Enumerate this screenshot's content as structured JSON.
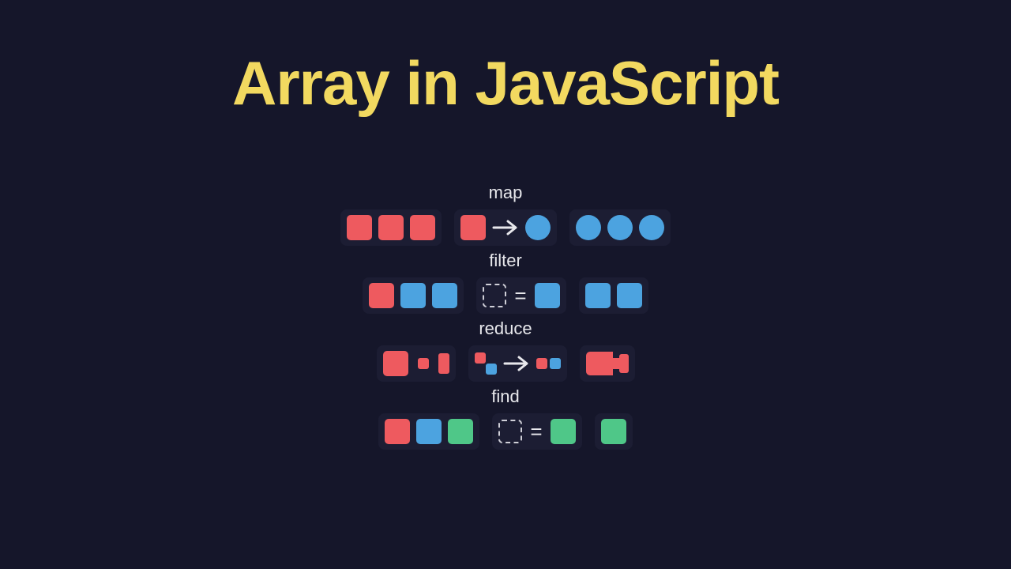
{
  "title": "Array in JavaScript",
  "colors": {
    "red": "#ee5a5f",
    "blue": "#4ca3e0",
    "green": "#4fc788",
    "bg": "#15162a",
    "panel": "#1c1d33",
    "title": "#f2d960",
    "text": "#e8e8ec"
  },
  "methods": {
    "map": {
      "label": "map",
      "input": [
        "red",
        "red",
        "red"
      ],
      "transform": {
        "from": "red-square",
        "to": "blue-circle"
      },
      "output": [
        "blue",
        "blue",
        "blue"
      ]
    },
    "filter": {
      "label": "filter",
      "input": [
        "red",
        "blue",
        "blue"
      ],
      "predicate": {
        "placeholder": "dashed",
        "equals": "blue"
      },
      "output": [
        "blue",
        "blue"
      ]
    },
    "reduce": {
      "label": "reduce",
      "input": [
        "large",
        "small",
        "tall"
      ],
      "transform": {
        "pair": [
          "red",
          "blue"
        ],
        "to_pair": [
          "red",
          "blue"
        ]
      },
      "output": "combined-red"
    },
    "find": {
      "label": "find",
      "input": [
        "red",
        "blue",
        "green"
      ],
      "predicate": {
        "placeholder": "dashed",
        "equals": "green"
      },
      "output": [
        "green"
      ]
    }
  }
}
